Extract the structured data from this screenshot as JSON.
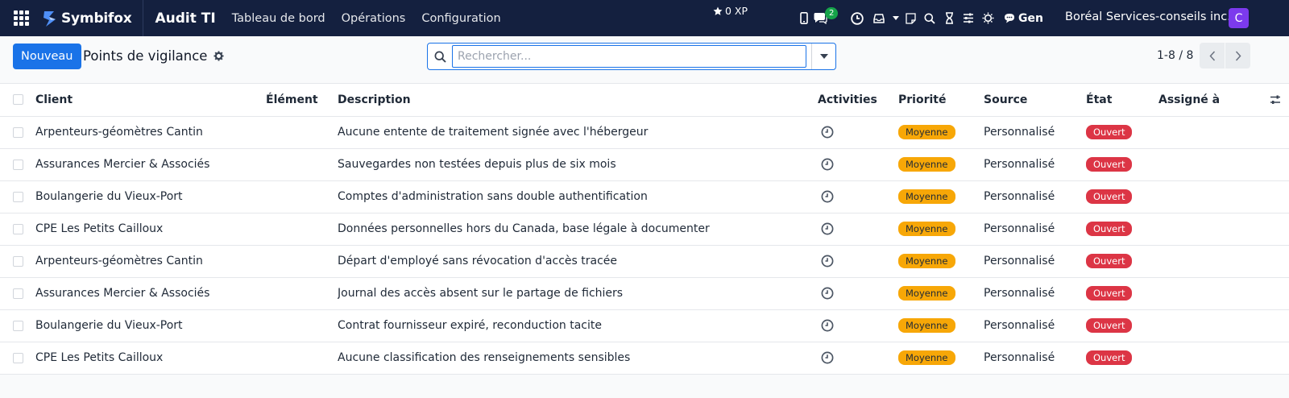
{
  "navbar": {
    "brand": "Symbifox",
    "app_name": "Audit TI",
    "menu": [
      "Tableau de bord",
      "Opérations",
      "Configuration"
    ],
    "xp": "0 XP",
    "messages_count": "2",
    "gen_label": "Gen",
    "company": "Boréal Services-conseils inc.",
    "avatar_letter": "C"
  },
  "control": {
    "new_label": "Nouveau",
    "page_title": "Points de vigilance",
    "search_placeholder": "Rechercher...",
    "pager": "1-8 / 8"
  },
  "table": {
    "columns": {
      "client": "Client",
      "element": "Élément",
      "description": "Description",
      "activities": "Activities",
      "priority": "Priorité",
      "source": "Source",
      "state": "État",
      "assigned": "Assigné à"
    },
    "rows": [
      {
        "client": "Arpenteurs-géomètres Cantin",
        "element": "",
        "description": "Aucune entente de traitement signée avec l'hébergeur",
        "priority": "Moyenne",
        "source": "Personnalisé",
        "state": "Ouvert",
        "assigned": ""
      },
      {
        "client": "Assurances Mercier & Associés",
        "element": "",
        "description": "Sauvegardes non testées depuis plus de six mois",
        "priority": "Moyenne",
        "source": "Personnalisé",
        "state": "Ouvert",
        "assigned": ""
      },
      {
        "client": "Boulangerie du Vieux-Port",
        "element": "",
        "description": "Comptes d'administration sans double authentification",
        "priority": "Moyenne",
        "source": "Personnalisé",
        "state": "Ouvert",
        "assigned": ""
      },
      {
        "client": "CPE Les Petits Cailloux",
        "element": "",
        "description": "Données personnelles hors du Canada, base légale à documenter",
        "priority": "Moyenne",
        "source": "Personnalisé",
        "state": "Ouvert",
        "assigned": ""
      },
      {
        "client": "Arpenteurs-géomètres Cantin",
        "element": "",
        "description": "Départ d'employé sans révocation d'accès tracée",
        "priority": "Moyenne",
        "source": "Personnalisé",
        "state": "Ouvert",
        "assigned": ""
      },
      {
        "client": "Assurances Mercier & Associés",
        "element": "",
        "description": "Journal des accès absent sur le partage de fichiers",
        "priority": "Moyenne",
        "source": "Personnalisé",
        "state": "Ouvert",
        "assigned": ""
      },
      {
        "client": "Boulangerie du Vieux-Port",
        "element": "",
        "description": "Contrat fournisseur expiré, reconduction tacite",
        "priority": "Moyenne",
        "source": "Personnalisé",
        "state": "Ouvert",
        "assigned": ""
      },
      {
        "client": "CPE Les Petits Cailloux",
        "element": "",
        "description": "Aucune classification des renseignements sensibles",
        "priority": "Moyenne",
        "source": "Personnalisé",
        "state": "Ouvert",
        "assigned": ""
      }
    ]
  },
  "colors": {
    "navbar_bg": "#14203f",
    "primary": "#1a73e8",
    "priority_badge": "#f7a707",
    "state_badge": "#dc3545",
    "avatar": "#7c3aed"
  }
}
